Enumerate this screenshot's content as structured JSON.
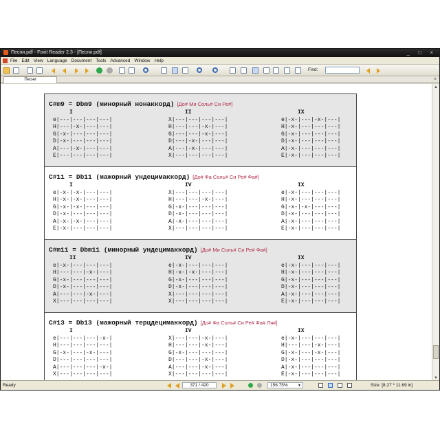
{
  "window": {
    "title": "Песни.pdf - Foxit Reader 2.3 - [Песни.pdf]",
    "controls": "_ □ ×"
  },
  "menu": [
    "File",
    "Edit",
    "View",
    "Language",
    "Document",
    "Tools",
    "Advanced",
    "Window",
    "Help"
  ],
  "toolbar": {
    "find_label": "Find:",
    "find_value": "",
    "icons": [
      "open-icon",
      "save-icon",
      "print-icon",
      "email-icon",
      "first-page-icon",
      "prev-page-icon",
      "next-page-icon",
      "last-page-icon",
      "go-back-icon",
      "go-forward-icon",
      "hand-tool-icon",
      "select-text-icon",
      "zoom-icon",
      "actual-size-icon",
      "fit-page-icon",
      "fit-width-icon",
      "zoom-out-icon",
      "zoom-in-icon",
      "single-page-icon",
      "continuous-icon",
      "facing-icon",
      "rotate-icon",
      "snapshot-icon",
      "find-binoculars-icon",
      "typewriter-icon",
      "bookmark-icon",
      "search-icon",
      "find-prev-icon",
      "find-next-icon"
    ]
  },
  "tab": {
    "label": "Песни",
    "close": "×"
  },
  "document": {
    "blocks": [
      {
        "title": "C#m9 = Dbm9 (минорный нонаккорд)",
        "notes": "[До# Ми Соль# Си Ре#]",
        "shaded": true,
        "columns": [
          {
            "label": "I",
            "lines": [
              "e|---|---|---|---|",
              "H|---|-x-|---|---|",
              "G|-x-|---|---|---|",
              "D|-x-|---|---|---|",
              "A|---|-x-|---|---|",
              "E|---|---|---|---|"
            ]
          },
          {
            "label": "II",
            "lines": [
              "X|---|---|---|---|",
              "H|---|---|-x-|---|",
              "G|---|---|-x-|---|",
              "D|---|-x-|---|---|",
              "A|---|-x-|---|---|",
              "X|---|---|---|---|"
            ]
          },
          {
            "label": "IX",
            "lines": [
              "e|-x-|---|-x-|---|",
              "H|-x-|---|---|---|",
              "G|-x-|---|---|---|",
              "D|-x-|---|---|---|",
              "A|-x-|---|---|---|",
              "E|-x-|---|---|---|"
            ]
          }
        ]
      },
      {
        "title": "C#11 = Db11 (мажорный ундецимаккорд)",
        "notes": "[До# Фа Соль# Си Ре# Фа#]",
        "shaded": false,
        "columns": [
          {
            "label": "I",
            "lines": [
              "e|-x-|-x-|---|---|",
              "H|-x-|-x-|---|---|",
              "G|-x-|-x-|---|---|",
              "D|-x-|---|---|---|",
              "A|-x-|-x-|---|---|",
              "E|-x-|---|---|---|"
            ]
          },
          {
            "label": "IV",
            "lines": [
              "X|---|---|---|---|",
              "H|---|---|-x-|---|",
              "G|-x-|---|---|---|",
              "D|-x-|---|---|---|",
              "A|-x-|---|---|---|",
              "X|---|---|---|---|"
            ]
          },
          {
            "label": "IX",
            "lines": [
              "e|-x-|---|---|---|",
              "H|-x-|---|---|---|",
              "G|-x-|-x-|---|---|",
              "D|-x-|---|---|---|",
              "A|-x-|---|---|---|",
              "E|-x-|---|---|---|"
            ]
          }
        ]
      },
      {
        "title": "C#m11 = Dbm11 (минорный ундецимаккорд)",
        "notes": "[До# Ми Соль# Си Ре# Фа#]",
        "shaded": true,
        "columns": [
          {
            "label": "II",
            "lines": [
              "e|-x-|---|---|---|",
              "H|---|---|-x-|---|",
              "G|-x-|---|---|---|",
              "D|-x-|---|---|---|",
              "A|---|---|-x-|---|",
              "X|---|---|---|---|"
            ]
          },
          {
            "label": "IV",
            "lines": [
              "e|-x-|---|---|---|",
              "H|-x-|-x-|---|---|",
              "G|-x-|---|---|---|",
              "D|-x-|---|---|---|",
              "X|---|---|---|---|",
              "X|---|---|---|---|"
            ]
          },
          {
            "label": "IX",
            "lines": [
              "e|-x-|---|---|---|",
              "H|-x-|---|---|---|",
              "G|-x-|---|---|---|",
              "D|-x-|---|---|---|",
              "A|-x-|---|---|---|",
              "E|-x-|---|---|---|"
            ]
          }
        ]
      },
      {
        "title": "C#13 = Db13 (мажорный терцдецимаккорд)",
        "notes": "[До# Фа Соль# Си Ре# Фа# Ля#]",
        "shaded": false,
        "columns": [
          {
            "label": "I",
            "lines": [
              "e|---|---|---|-x-|",
              "H|---|---|---|---|",
              "G|-x-|---|-x-|---|",
              "D|---|---|---|---|",
              "A|---|---|---|-x-|",
              "X|---|---|---|---|"
            ]
          },
          {
            "label": "IV",
            "lines": [
              "X|---|---|-x-|---|",
              "H|---|---|-x-|---|",
              "G|-x-|---|---|---|",
              "D|---|---|-x-|---|",
              "A|---|---|-x-|---|",
              "X|---|---|---|---|"
            ]
          },
          {
            "label": "IX",
            "lines": [
              "e|-x-|---|---|---|",
              "H|---|---|-x-|---|",
              "G|-x-|---|-x-|---|",
              "D|-x-|---|---|---|",
              "A|-x-|---|---|---|",
              "E|-x-|---|---|---|"
            ]
          }
        ]
      }
    ]
  },
  "statusbar": {
    "status": "Ready",
    "page_counter": "371 / 420",
    "zoom": "156.75%",
    "size": "Size: [8.27 * 11.69 in]"
  }
}
